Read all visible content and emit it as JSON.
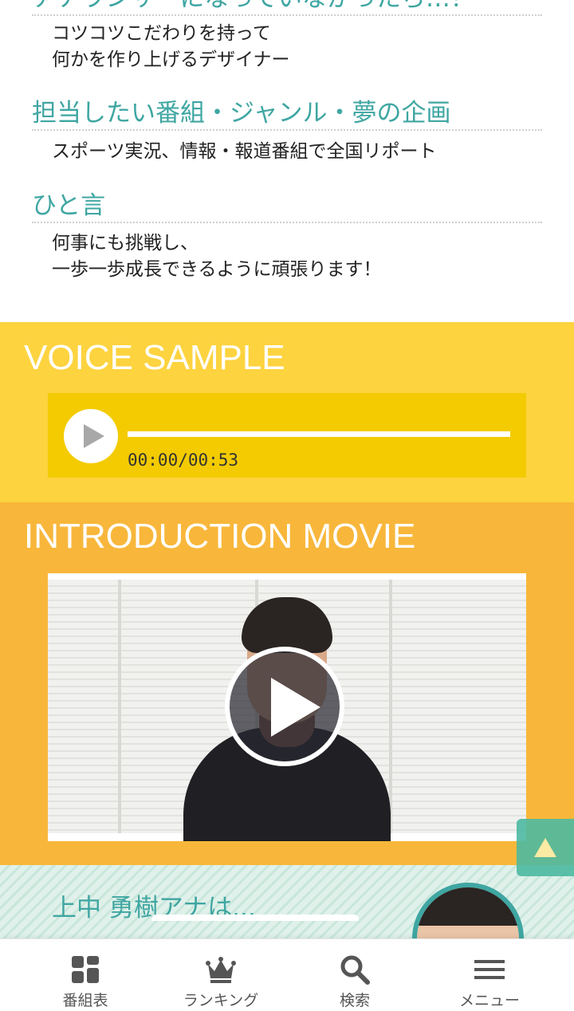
{
  "profile": {
    "partial_heading": "アナウンサーになっていなかったら…？",
    "partial_answer": "コツコツこだわりを持って\n何かを作り上げるデザイナー",
    "program_heading": "担当したい番組・ジャンル・夢の企画",
    "program_answer": "スポーツ実況、情報・報道番組で全国リポート",
    "comment_heading": "ひと言",
    "comment_answer": "何事にも挑戦し、\n一歩一歩成長できるように頑張ります！"
  },
  "voice_sample": {
    "title": "VOICE SAMPLE",
    "time": "00:00/00:53",
    "progress": 0
  },
  "movie": {
    "title": "INTRODUCTION MOVIE"
  },
  "teaser": {
    "text": "上中 勇樹アナは..."
  },
  "nav": {
    "items": [
      {
        "label": "番組表",
        "icon": "grid-icon"
      },
      {
        "label": "ランキング",
        "icon": "crown-icon"
      },
      {
        "label": "検索",
        "icon": "search-icon"
      },
      {
        "label": "メニュー",
        "icon": "hamburger-menu-icon"
      }
    ]
  },
  "colors": {
    "accent_teal": "#3fa6a2",
    "voice_bg": "#fdd33f",
    "movie_bg": "#f8b73b",
    "player_bg": "#f3cb00"
  }
}
